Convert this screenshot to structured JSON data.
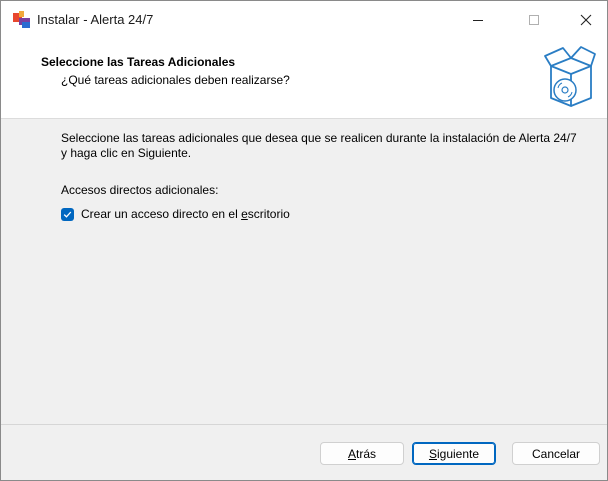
{
  "window": {
    "title": "Instalar - Alerta 24/7",
    "controls": {
      "minimize": "—",
      "maximize": "☐",
      "close": "✕"
    }
  },
  "header": {
    "title": "Seleccione las Tareas Adicionales",
    "subtitle": "¿Qué tareas adicionales deben realizarse?"
  },
  "content": {
    "description": "Seleccione las tareas adicionales que desea que se realicen durante la instalación de Alerta 24/7 y haga clic en Siguiente.",
    "group_label": "Accesos directos adicionales:",
    "tasks": [
      {
        "label_pre": "Crear un acceso directo en el ",
        "label_mnemonic": "e",
        "label_post": "scritorio",
        "checked": true
      }
    ]
  },
  "buttons": {
    "back": {
      "mnemonic": "A",
      "rest": "trás"
    },
    "next": {
      "mnemonic": "S",
      "rest": "iguiente"
    },
    "cancel": "Cancelar"
  },
  "colors": {
    "accent": "#0067c0",
    "background": "#f0f0f0",
    "header_bg": "#ffffff"
  },
  "icons": {
    "app": "installer-app-icon",
    "header": "software-box-icon"
  }
}
